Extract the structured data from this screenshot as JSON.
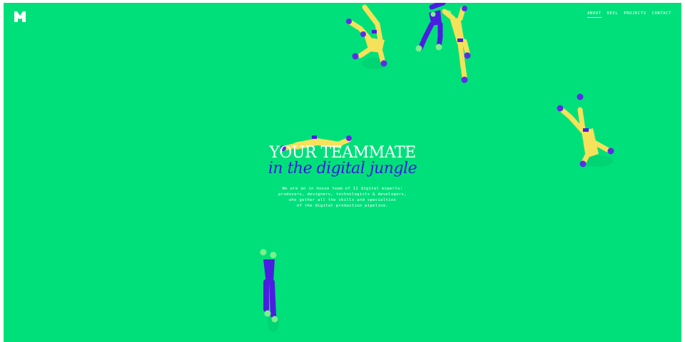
{
  "brand": {
    "logo_icon": "studio-m-logo-icon"
  },
  "nav": {
    "items": [
      {
        "label": "ABOUT",
        "active": true
      },
      {
        "label": "REEL",
        "active": false
      },
      {
        "label": "PROJECTS",
        "active": false
      },
      {
        "label": "CONTACT",
        "active": false
      }
    ]
  },
  "hero": {
    "title": "YOUR TEAMMATE",
    "subtitle": "in the digital jungle",
    "description": [
      "We are an in house team of 11 digital experts:",
      "producers, designers, technologists & developers,",
      "who gather all the skills and specialties",
      "of the digital production pipeline."
    ]
  },
  "colors": {
    "background": "#00e07a",
    "title": "#ffffff",
    "subtitle": "#3a14e6",
    "figure_yellow": "#f6e15a",
    "figure_purple": "#4a1ee0",
    "figure_green": "#7cf08c"
  }
}
